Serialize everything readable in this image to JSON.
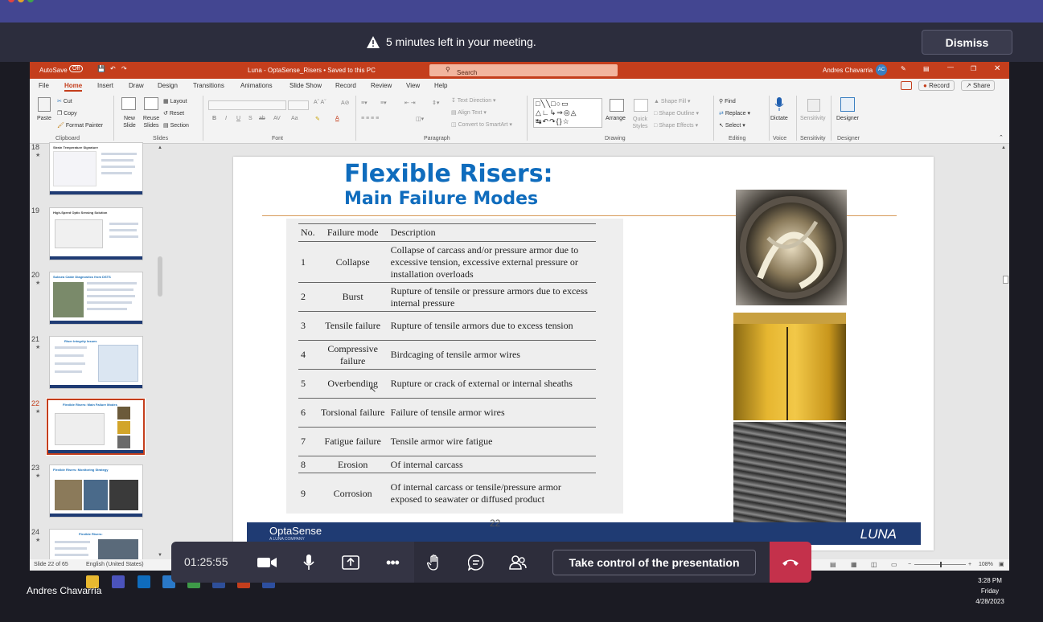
{
  "meeting_banner": {
    "message": "5 minutes left in your meeting.",
    "dismiss_label": "Dismiss"
  },
  "ppt": {
    "autosave_label": "AutoSave",
    "autosave_state": "Off",
    "file_title": "Luna - OptaSense_Risers  •  Saved to this PC",
    "search_placeholder": "Search",
    "user_name": "Andres Chavarria",
    "user_initials": "AC",
    "tabs": [
      "File",
      "Home",
      "Insert",
      "Draw",
      "Design",
      "Transitions",
      "Animations",
      "Slide Show",
      "Record",
      "Review",
      "View",
      "Help"
    ],
    "record_label": "Record",
    "share_label": "Share",
    "ribbon": {
      "clipboard": {
        "paste": "Paste",
        "cut": "Cut",
        "copy": "Copy",
        "format_painter": "Format Painter",
        "group": "Clipboard"
      },
      "slides": {
        "new_slide": "New Slide",
        "reuse_slides": "Reuse Slides",
        "layout": "Layout",
        "reset": "Reset",
        "section": "Section",
        "group": "Slides"
      },
      "font": {
        "group": "Font"
      },
      "paragraph": {
        "text_direction": "Text Direction",
        "align_text": "Align Text",
        "convert_smartart": "Convert to SmartArt",
        "group": "Paragraph"
      },
      "drawing": {
        "arrange": "Arrange",
        "quick_styles": "Quick Styles",
        "shape_fill": "Shape Fill",
        "shape_outline": "Shape Outline",
        "shape_effects": "Shape Effects",
        "group": "Drawing"
      },
      "editing": {
        "find": "Find",
        "replace": "Replace",
        "select": "Select",
        "group": "Editing"
      },
      "voice": {
        "dictate": "Dictate",
        "group": "Voice"
      },
      "sensitivity": {
        "label": "Sensitivity",
        "group": "Sensitivity"
      },
      "designer": {
        "label": "Designer",
        "group": "Designer"
      }
    },
    "thumbnails": [
      {
        "num": "18",
        "title": "Strain Temperature Signature"
      },
      {
        "num": "19",
        "title": "High-Speed Optic Sensing Solution"
      },
      {
        "num": "20",
        "title": "Subsea Cable Diagnostics from DSTS"
      },
      {
        "num": "21",
        "title": "Riser Integrity Issues"
      },
      {
        "num": "22",
        "title": "Flexible Risers: Main Failure Modes"
      },
      {
        "num": "23",
        "title": "Flexible Risers: Monitoring Strategy"
      },
      {
        "num": "24",
        "title": "Flexible Risers:"
      }
    ],
    "slide": {
      "title_line1": "Flexible Risers:",
      "title_line2": "Main Failure Modes",
      "table": {
        "headers": [
          "No.",
          "Failure mode",
          "Description"
        ],
        "rows": [
          {
            "no": "1",
            "mode": "Collapse",
            "desc": "Collapse of carcass and/or pressure armor due to excessive tension, excessive external pressure or installation overloads"
          },
          {
            "no": "2",
            "mode": "Burst",
            "desc": "Rupture of tensile or pressure armors due to excess internal pressure"
          },
          {
            "no": "3",
            "mode": "Tensile failure",
            "desc": "Rupture of tensile armors due to excess tension"
          },
          {
            "no": "4",
            "mode": "Compressive failure",
            "desc": "Birdcaging of tensile armor wires"
          },
          {
            "no": "5",
            "mode": "Overbending",
            "desc": "Rupture or crack of external or internal sheaths"
          },
          {
            "no": "6",
            "mode": "Torsional failure",
            "desc": "Failure of tensile armor wires"
          },
          {
            "no": "7",
            "mode": "Fatigue failure",
            "desc": "Tensile armor wire fatigue"
          },
          {
            "no": "8",
            "mode": "Erosion",
            "desc": "Of internal carcass"
          },
          {
            "no": "9",
            "mode": "Corrosion",
            "desc": "Of internal carcass or tensile/pressure armor exposed to seawater or diffused product"
          }
        ]
      },
      "footer_logo_left": "OptaSense",
      "footer_logo_left_sub": "A LUNA COMPANY",
      "footer_logo_right": "LUNA",
      "page_number": "22"
    },
    "status": {
      "slide_info": "Slide 22 of 65",
      "language": "English (United States)",
      "zoom": "108%"
    }
  },
  "call": {
    "timer": "01:25:55",
    "take_control_label": "Take control of the presentation",
    "presenter_name": "Andres Chavarria"
  },
  "clock": {
    "time": "3:28 PM",
    "day": "Friday",
    "date": "4/28/2023"
  }
}
